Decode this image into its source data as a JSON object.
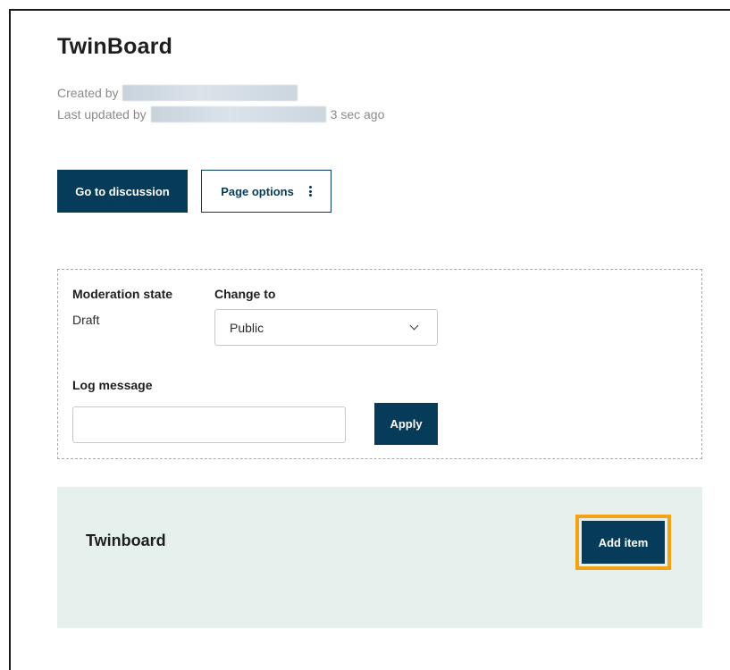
{
  "page": {
    "title": "TwinBoard",
    "created_by_label": "Created by",
    "last_updated_by_label": "Last updated by",
    "last_updated_ago": "3 sec ago"
  },
  "actions": {
    "go_to_discussion_label": "Go to discussion",
    "page_options_label": "Page options",
    "page_options_icon": "kebab-menu-icon"
  },
  "moderation": {
    "state_label": "Moderation state",
    "state_value": "Draft",
    "change_to_label": "Change to",
    "change_to_selected": "Public",
    "log_message_label": "Log message",
    "log_message_value": "",
    "apply_label": "Apply"
  },
  "twinboard": {
    "section_title": "Twinboard",
    "add_item_label": "Add item"
  },
  "colors": {
    "primary": "#073b5a",
    "section_background": "#e6f1ee",
    "focus_outline": "#f5a316",
    "meta_text": "#8a8a8a"
  }
}
